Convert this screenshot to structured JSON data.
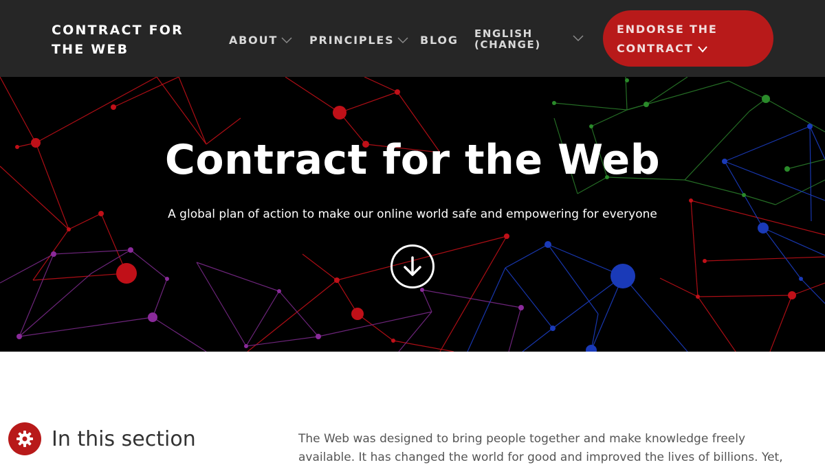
{
  "header": {
    "logo": "CONTRACT FOR THE WEB",
    "nav": {
      "about": "ABOUT",
      "principles": "PRINCIPLES",
      "blog": "BLOG",
      "language": "ENGLISH (CHANGE)"
    },
    "cta": "ENDORSE THE CONTRACT"
  },
  "hero": {
    "title": "Contract for the Web",
    "subtitle": "A global plan of action to make our online world safe and empowering for everyone",
    "scroll_icon": "arrow-down-circle-icon"
  },
  "section": {
    "heading": "In this section",
    "intro": "The Web was designed to bring people together and make knowledge freely available. It has changed the world for good and improved the lives of billions. Yet,"
  },
  "settings_icon": "gear-icon",
  "colors": {
    "nav_bg": "#262626",
    "accent_red": "#b81a1a",
    "hero_bg": "#000000",
    "network_red": "#d0101a",
    "network_blue": "#1a3fd0",
    "network_green": "#2e8a2e",
    "network_purple": "#8a2a9a"
  }
}
